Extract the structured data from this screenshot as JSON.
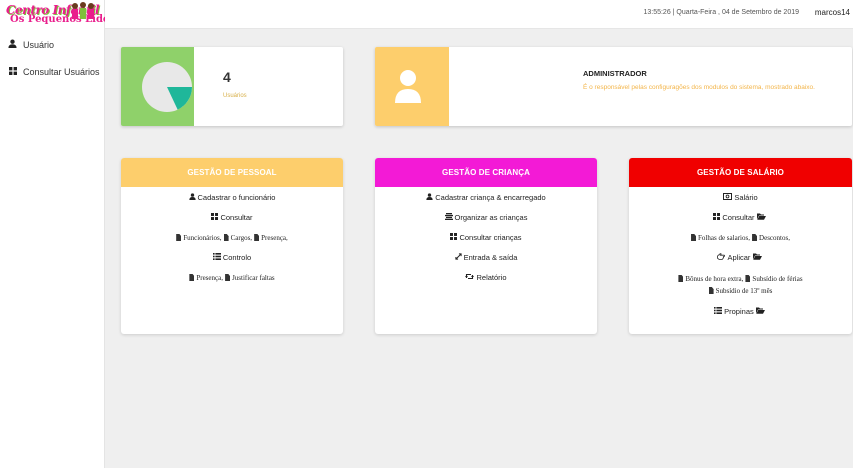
{
  "logo": {
    "line1": "Centro Infantil",
    "line2": "Os Pequenos Líderes"
  },
  "sidebar": {
    "items": [
      {
        "label": "Usuário",
        "icon": "user-icon"
      },
      {
        "label": "Consultar Usuários",
        "icon": "grid-icon"
      }
    ]
  },
  "topbar": {
    "datetime": "13:55:26 | Quarta-Feira , 04 de Setembro de 2019",
    "user": "marcos14"
  },
  "stats": {
    "users_count": "4",
    "users_label": "Usuários",
    "pie_fraction": 0.18,
    "colors": {
      "pie_slice": "#1fb79a",
      "pie_base": "#e8e8e8",
      "tile": "#8fd16a"
    }
  },
  "role": {
    "title": "ADMINISTRADOR",
    "description": "É o responsável pelas configuragões dos modulos do sistema, mostrado abaixo.",
    "icon": "person-icon"
  },
  "panels": {
    "pessoal": {
      "title": "GESTÃO DE PESSOAL",
      "color": "#fdce6c",
      "cadastrar": "Cadastrar o funcionário",
      "consultar": "Consultar",
      "funcionarios": "Funcionários,",
      "cargos": "Cargos,",
      "presenca": "Presença,",
      "controlo": "Controlo",
      "presenca2": "Presença,",
      "justificar": "Justificar faltas"
    },
    "crianca": {
      "title": "GESTÃO DE CRIANÇA",
      "color": "#f31ad6",
      "cadastrar": "Cadastrar criança & encarregado",
      "organizar": "Organizar as crianças",
      "consultar": "Consultar crianças",
      "entrada": "Entrada & saída",
      "relatorio": "Relatório"
    },
    "salario": {
      "title": "GESTÃO DE SALÁRIO",
      "color": "#f00000",
      "salario": "Salário",
      "consultar": "Consultar",
      "folhas": "Folhas de salarios,",
      "descontos": "Descontos,",
      "aplicar": "Aplicar",
      "bonus": "Bônus de hora extra,",
      "subsidio_ferias": "Subsídio de férias",
      "subsidio_13": "Subsídio de 13º mês",
      "propinas": "Propinas"
    }
  }
}
